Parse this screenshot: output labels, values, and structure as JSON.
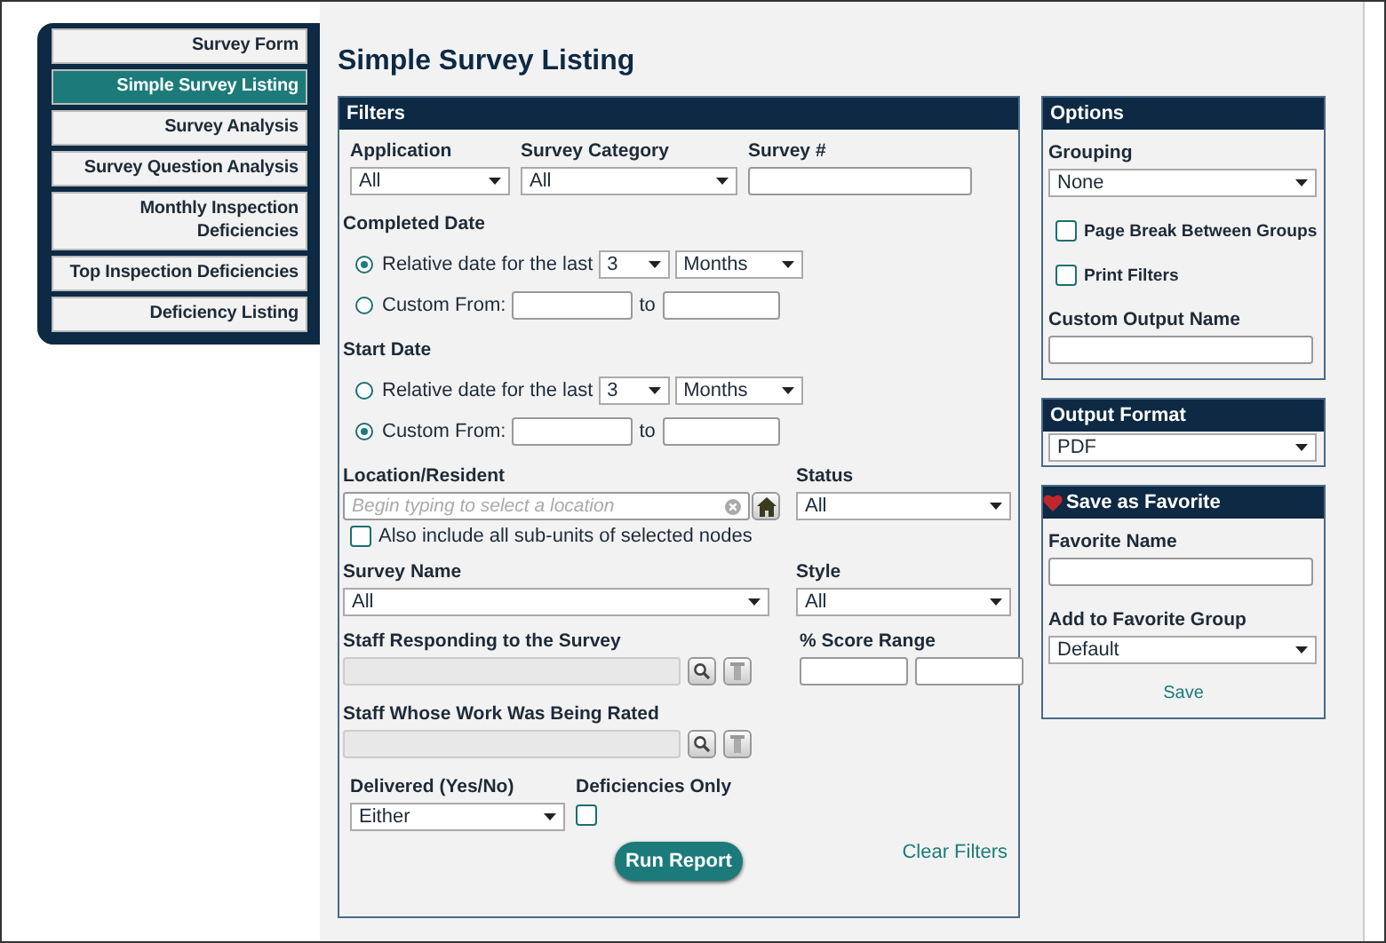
{
  "nav": {
    "items": [
      {
        "label": "Survey Form",
        "selected": false
      },
      {
        "label": "Simple Survey Listing",
        "selected": true
      },
      {
        "label": "Survey Analysis",
        "selected": false
      },
      {
        "label": "Survey Question Analysis",
        "selected": false
      },
      {
        "label": "Monthly Inspection Deficiencies",
        "selected": false
      },
      {
        "label": "Top Inspection Deficiencies",
        "selected": false
      },
      {
        "label": "Deficiency Listing",
        "selected": false
      }
    ]
  },
  "page_title": "Simple Survey Listing",
  "filters": {
    "title": "Filters",
    "application": {
      "label": "Application",
      "value": "All"
    },
    "survey_category": {
      "label": "Survey Category",
      "value": "All"
    },
    "survey_number": {
      "label": "Survey #"
    },
    "date_groups": [
      {
        "label": "Completed Date",
        "options": [
          {
            "kind": "relative",
            "label": "Relative date for the last",
            "selected": true,
            "number": "3",
            "unit": "Months"
          },
          {
            "kind": "custom",
            "label": "Custom From:",
            "selected": false,
            "to_label": "to"
          }
        ]
      },
      {
        "label": "Start Date",
        "options": [
          {
            "kind": "relative",
            "label": "Relative date for the last",
            "selected": false,
            "number": "3",
            "unit": "Months"
          },
          {
            "kind": "custom",
            "label": "Custom From:",
            "selected": true,
            "to_label": "to"
          }
        ]
      }
    ],
    "location": {
      "label": "Location/Resident",
      "placeholder": "Begin typing to select a location"
    },
    "status": {
      "label": "Status",
      "value": "All"
    },
    "include_subunits": {
      "label": "Also include all sub-units of selected nodes",
      "checked": false
    },
    "survey_name": {
      "label": "Survey Name",
      "value": "All"
    },
    "style": {
      "label": "Style",
      "value": "All"
    },
    "staff_responding": {
      "label": "Staff Responding to the Survey"
    },
    "score_range": {
      "label": "% Score Range"
    },
    "staff_rated": {
      "label": "Staff Whose Work Was Being Rated"
    },
    "delivered": {
      "label": "Delivered (Yes/No)",
      "value": "Either"
    },
    "deficiencies_only": {
      "label": "Deficiencies Only",
      "checked": false
    },
    "run_button": "Run Report",
    "clear_link": "Clear Filters"
  },
  "options": {
    "title": "Options",
    "grouping": {
      "label": "Grouping",
      "value": "None"
    },
    "page_break": {
      "label": "Page Break Between Groups",
      "checked": false
    },
    "print_filters": {
      "label": "Print Filters",
      "checked": false
    },
    "custom_output_name": {
      "label": "Custom Output Name"
    }
  },
  "output_format": {
    "title": "Output Format",
    "value": "PDF"
  },
  "favorite": {
    "title": "Save as Favorite",
    "name_label": "Favorite Name",
    "group_label": "Add to Favorite Group",
    "group_value": "Default",
    "save_link": "Save"
  }
}
